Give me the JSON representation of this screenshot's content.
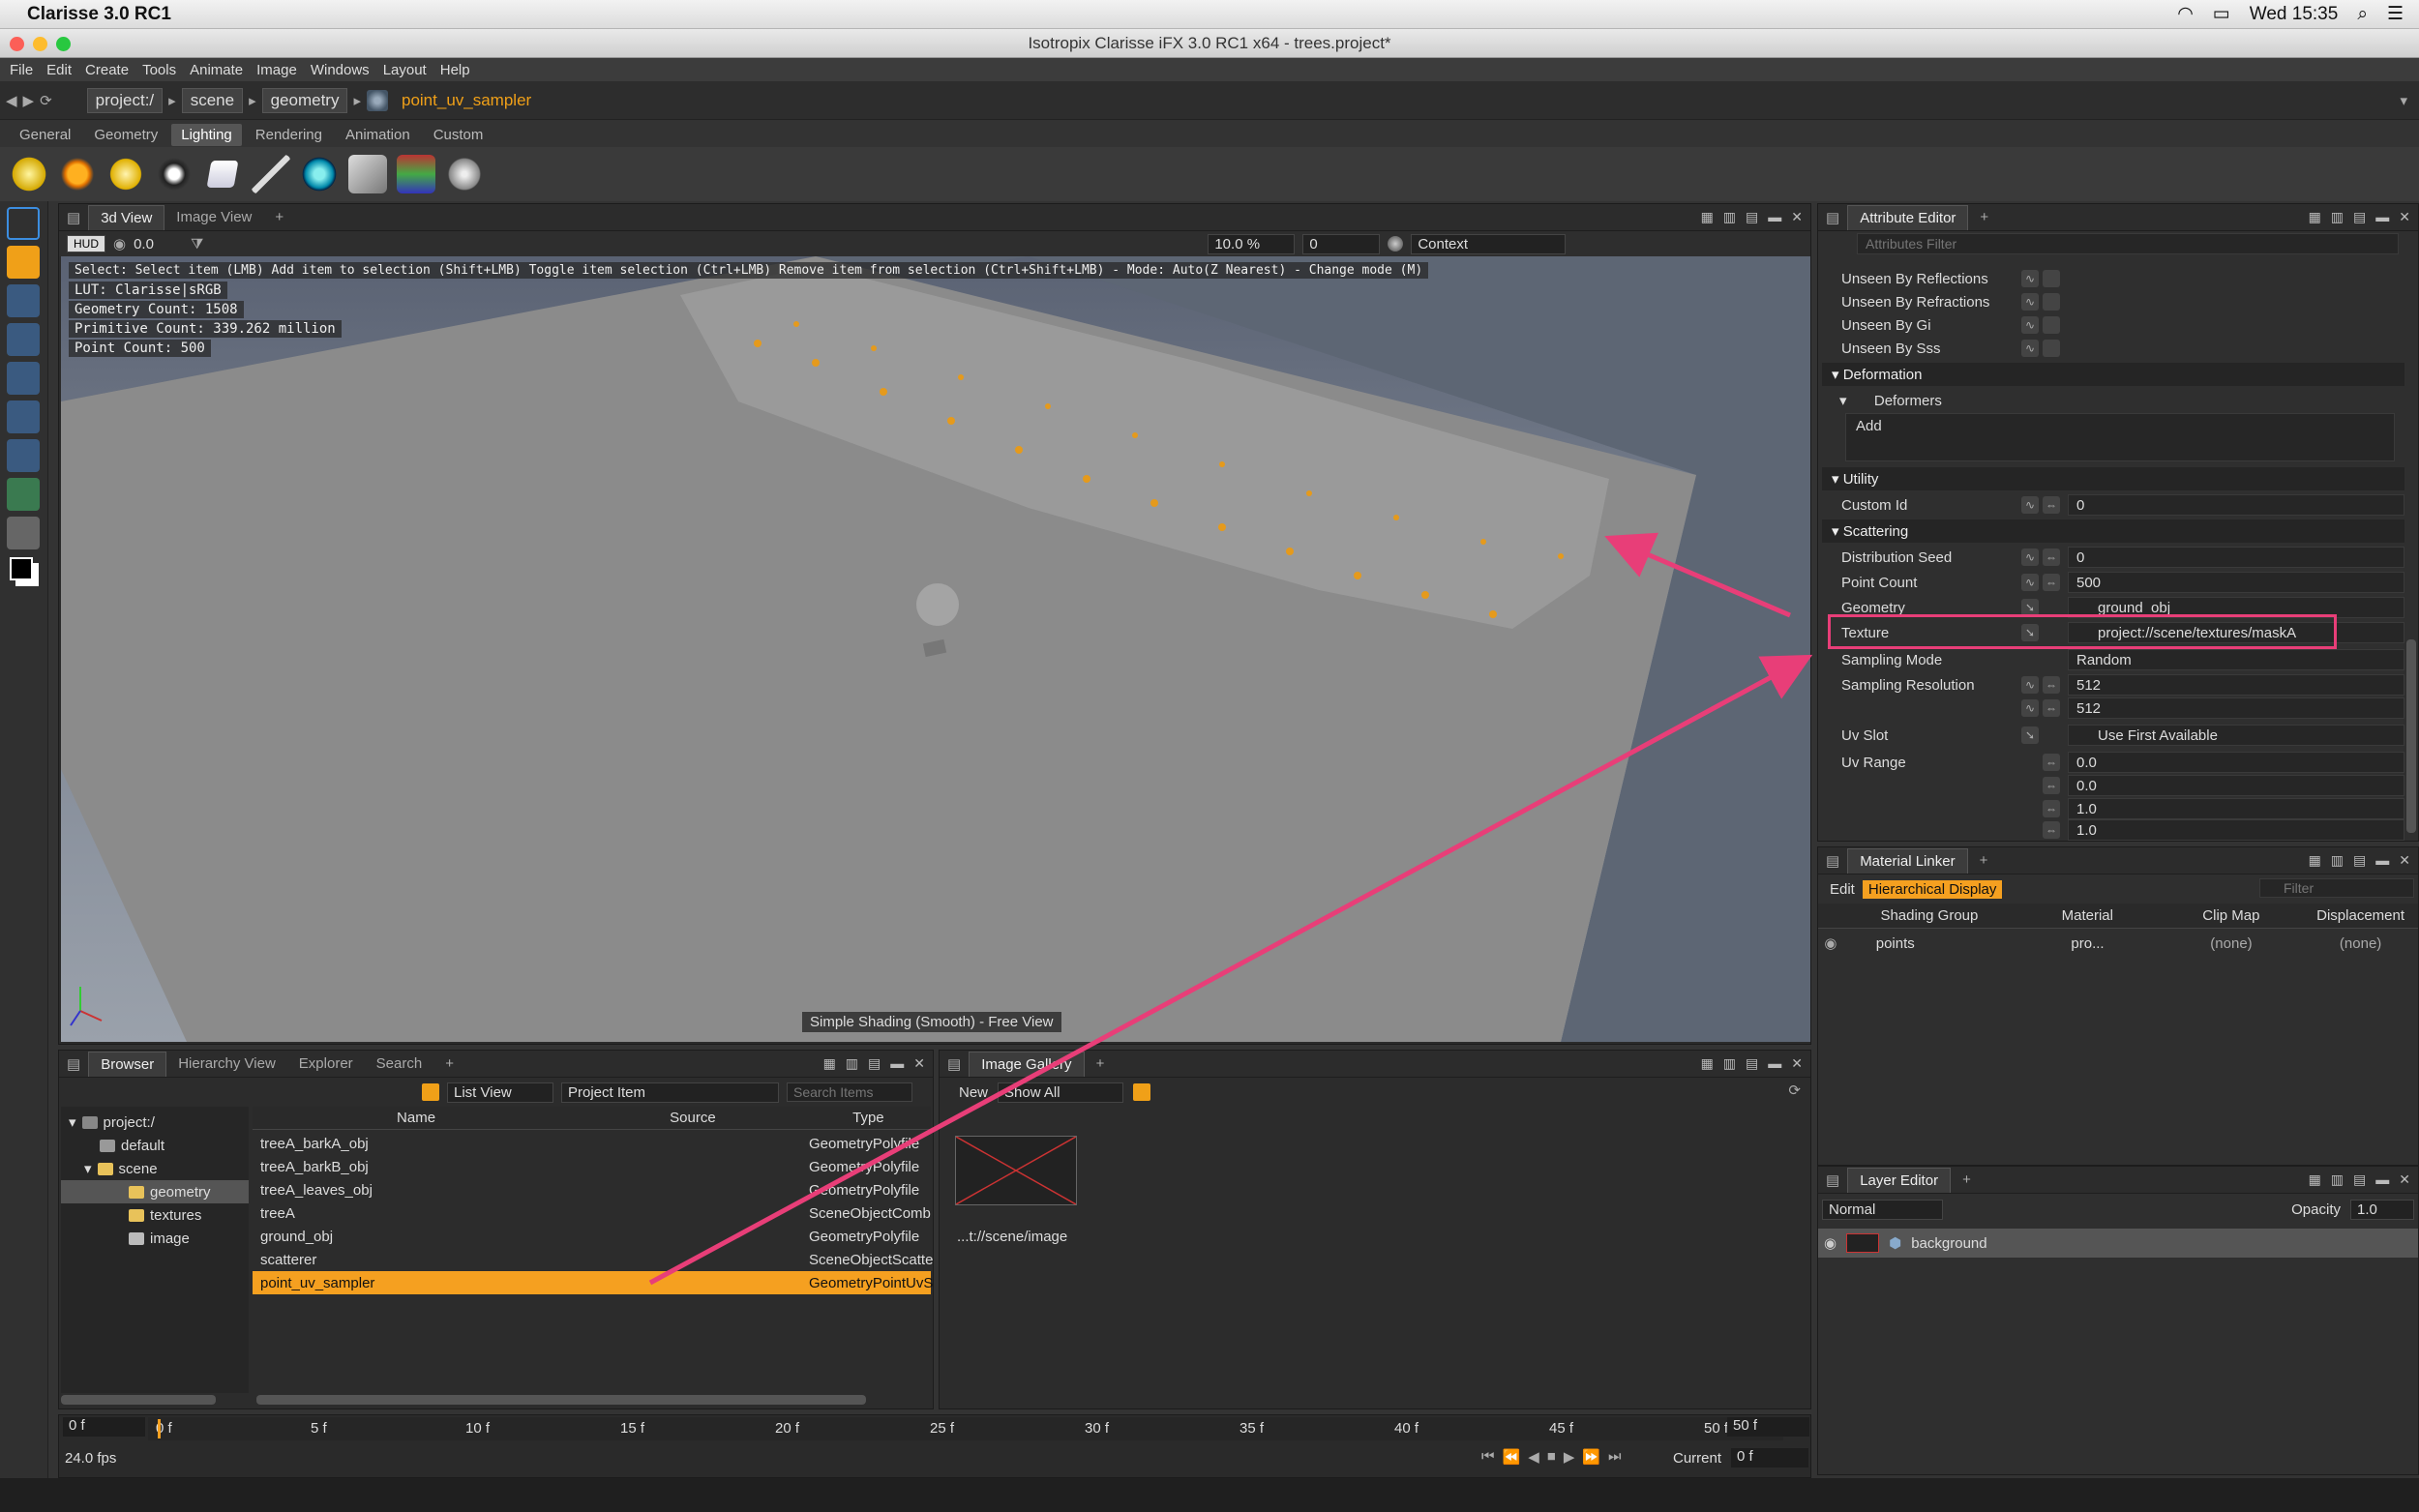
{
  "mac_menubar": {
    "app": "Clarisse 3.0 RC1",
    "clock": "Wed 15:35"
  },
  "window": {
    "title": "Isotropix Clarisse iFX 3.0 RC1 x64  -  trees.project*"
  },
  "menu": [
    "File",
    "Edit",
    "Create",
    "Tools",
    "Animate",
    "Image",
    "Windows",
    "Layout",
    "Help"
  ],
  "breadcrumb": [
    "project:/",
    "scene",
    "geometry",
    "point_uv_sampler"
  ],
  "shelf_tabs": [
    "General",
    "Geometry",
    "Lighting",
    "Rendering",
    "Animation",
    "Custom"
  ],
  "view3d": {
    "tabs": [
      "3d View",
      "Image View"
    ],
    "toolbar": {
      "hud": "HUD",
      "exposure": "0.0",
      "zoom": "10.0 %",
      "frame": "0",
      "context": "Context"
    },
    "hud_lines": [
      "Select: Select item (LMB)  Add item to selection (Shift+LMB)  Toggle item selection (Ctrl+LMB)  Remove item from selection (Ctrl+Shift+LMB)  - Mode: Auto(Z Nearest) - Change mode (M)",
      "LUT: Clarisse|sRGB",
      "Geometry Count: 1508",
      "Primitive Count: 339.262 million",
      "Point Count: 500"
    ],
    "shading": "Simple Shading (Smooth) - Free View"
  },
  "browser": {
    "tabs": [
      "Browser",
      "Hierarchy View",
      "Explorer",
      "Search"
    ],
    "view_mode": "List View",
    "filter": "Project Item",
    "search_placeholder": "Search Items",
    "tree": [
      "project:/",
      "default",
      "scene",
      "geometry",
      "textures",
      "image"
    ],
    "columns": [
      "Name",
      "Source",
      "Type"
    ],
    "rows": [
      {
        "name": "treeA_barkA_obj",
        "type": "GeometryPolyfile"
      },
      {
        "name": "treeA_barkB_obj",
        "type": "GeometryPolyfile"
      },
      {
        "name": "treeA_leaves_obj",
        "type": "GeometryPolyfile"
      },
      {
        "name": "treeA",
        "type": "SceneObjectComb"
      },
      {
        "name": "ground_obj",
        "type": "GeometryPolyfile"
      },
      {
        "name": "scatterer",
        "type": "SceneObjectScatte"
      },
      {
        "name": "point_uv_sampler",
        "type": "GeometryPointUvS"
      }
    ]
  },
  "gallery": {
    "tabs": [
      "Image Gallery"
    ],
    "new_label": "New",
    "show": "Show All",
    "item": "...t://scene/image"
  },
  "attr": {
    "title": "Attribute Editor",
    "filter_placeholder": "Attributes Filter",
    "unseen": [
      "Unseen By Reflections",
      "Unseen By Refractions",
      "Unseen By Gi",
      "Unseen By Sss"
    ],
    "deformation": {
      "title": "Deformation",
      "deformers": "Deformers",
      "add": "Add"
    },
    "utility": {
      "title": "Utility",
      "custom_id_label": "Custom Id",
      "custom_id": "0"
    },
    "scattering": {
      "title": "Scattering",
      "distribution_seed_label": "Distribution Seed",
      "distribution_seed": "0",
      "point_count_label": "Point Count",
      "point_count": "500",
      "geometry_label": "Geometry",
      "geometry": "ground_obj",
      "texture_label": "Texture",
      "texture": "project://scene/textures/maskA",
      "sampling_mode_label": "Sampling Mode",
      "sampling_mode": "Random",
      "sampling_res_label": "Sampling Resolution",
      "sampling_res": [
        "512",
        "512"
      ],
      "uv_slot_label": "Uv Slot",
      "uv_slot": "Use First Available",
      "uv_range_label": "Uv Range",
      "uv_range": [
        "0.0",
        "0.0",
        "1.0",
        "1.0"
      ]
    }
  },
  "material_linker": {
    "title": "Material Linker",
    "edit": "Edit",
    "mode": "Hierarchical Display",
    "filter": "Filter",
    "columns": [
      "Shading Group",
      "Material",
      "Clip Map",
      "Displacement"
    ],
    "row": {
      "group": "points",
      "material": "pro...",
      "clip": "(none)",
      "disp": "(none)"
    }
  },
  "layer_editor": {
    "title": "Layer Editor",
    "blend": "Normal",
    "opacity_label": "Opacity",
    "opacity": "1.0",
    "layer": "background"
  },
  "timeline": {
    "start": "0 f",
    "end": "50 f",
    "ticks": [
      "0 f",
      "5 f",
      "10 f",
      "15 f",
      "20 f",
      "25 f",
      "30 f",
      "35 f",
      "40 f",
      "45 f",
      "50 f"
    ],
    "fps": "24.0 fps",
    "current_label": "Current",
    "current": "0 f"
  },
  "colors": {
    "accent": "#f5a020",
    "highlight": "#e83e78"
  }
}
